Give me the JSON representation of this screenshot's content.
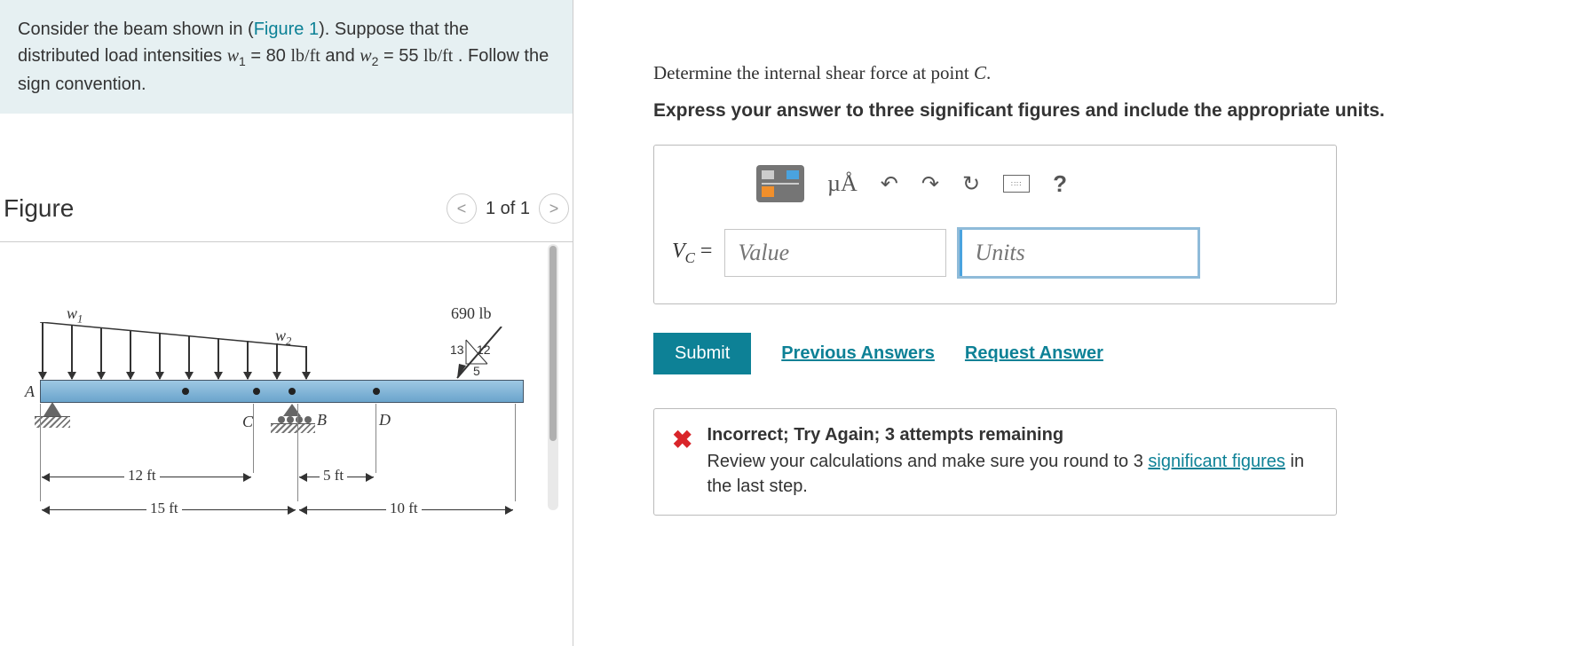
{
  "left": {
    "intro_a": "Consider the beam shown in (",
    "figure_link": "Figure 1",
    "intro_b": "). Suppose that the distributed load intensities ",
    "w1_var": "w",
    "w1_sub": "1",
    "w1_val": " = 80  ",
    "w1_units": "lb/ft",
    "intro_c": " and ",
    "w2_var": "w",
    "w2_sub": "2",
    "w2_val": " = 55  ",
    "w2_units": "lb/ft",
    "intro_d": " . Follow the sign convention.",
    "figure_title": "Figure",
    "nav_prev": "<",
    "nav_counter": "1 of 1",
    "nav_next": ">",
    "diagram": {
      "w1": "w",
      "w1s": "1",
      "w2": "w",
      "w2s": "2",
      "A": "A",
      "B": "B",
      "C": "C",
      "D": "D",
      "force": "690 lb",
      "tri_a": "13",
      "tri_b": "12",
      "tri_c": "5",
      "d12": "12 ft",
      "d5": "5 ft",
      "d15": "15 ft",
      "d10": "10 ft"
    }
  },
  "right": {
    "prompt1_a": "Determine the internal shear force at point ",
    "prompt1_var": "C",
    "prompt1_b": ".",
    "prompt2": "Express your answer to three significant figures and include the appropriate units.",
    "toolbar": {
      "units_label": "µÅ"
    },
    "vc_label_a": "V",
    "vc_label_sub": "C",
    "vc_label_b": " = ",
    "value_placeholder": "Value",
    "units_placeholder": "Units",
    "submit": "Submit",
    "prev_answers": "Previous Answers",
    "request_answer": "Request Answer",
    "feedback": {
      "title": "Incorrect; Try Again; 3 attempts remaining",
      "body_a": "Review your calculations and make sure you round to 3 ",
      "link": "significant figures",
      "body_b": " in the last step."
    }
  }
}
